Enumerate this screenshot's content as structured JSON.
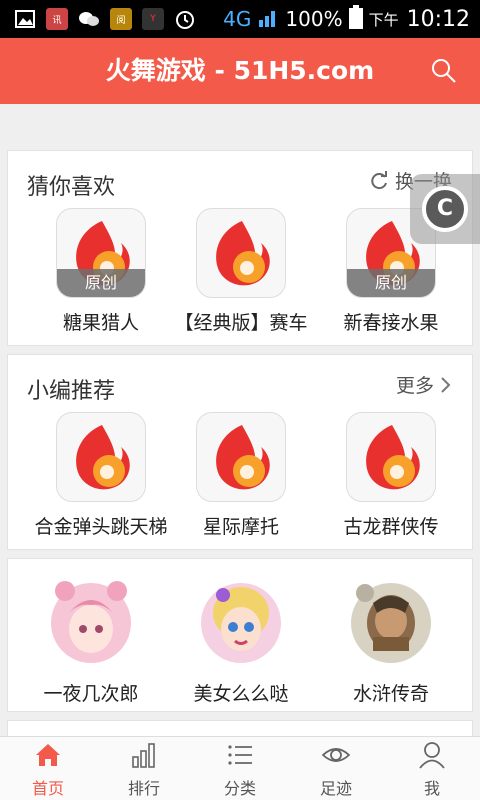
{
  "status_bar": {
    "icons": [
      "image-icon",
      "news-app-icon",
      "wechat-icon",
      "app-icon",
      "youku-icon",
      "alarm-icon"
    ],
    "network": "4G",
    "battery": "100%",
    "ampm": "下午",
    "time": "10:12"
  },
  "header": {
    "title": "火舞游戏 - 51H5.com"
  },
  "guess": {
    "title": "猜你喜欢",
    "action": "换一换",
    "items": [
      {
        "label": "糖果猎人",
        "badge": "原创"
      },
      {
        "label": "【经典版】赛车",
        "badge": ""
      },
      {
        "label": "新春接水果",
        "badge": "原创"
      }
    ]
  },
  "editor": {
    "title": "小编推荐",
    "action": "更多",
    "items": [
      {
        "label": "合金弹头跳天梯"
      },
      {
        "label": "星际摩托"
      },
      {
        "label": "古龙群侠传"
      }
    ]
  },
  "featured": {
    "items": [
      {
        "label": "一夜几次郎"
      },
      {
        "label": "美女么么哒"
      },
      {
        "label": "水浒传奇"
      }
    ]
  },
  "float_button": {
    "label": "C"
  },
  "nav": {
    "items": [
      {
        "label": "首页",
        "icon": "home-icon",
        "active": true
      },
      {
        "label": "排行",
        "icon": "rank-icon",
        "active": false
      },
      {
        "label": "分类",
        "icon": "category-icon",
        "active": false
      },
      {
        "label": "足迹",
        "icon": "eye-icon",
        "active": false
      },
      {
        "label": "我",
        "icon": "user-icon",
        "active": false
      }
    ]
  },
  "colors": {
    "brand": "#f35a4a",
    "flame": "#e8312f",
    "flame_core": "#f7a12a"
  }
}
